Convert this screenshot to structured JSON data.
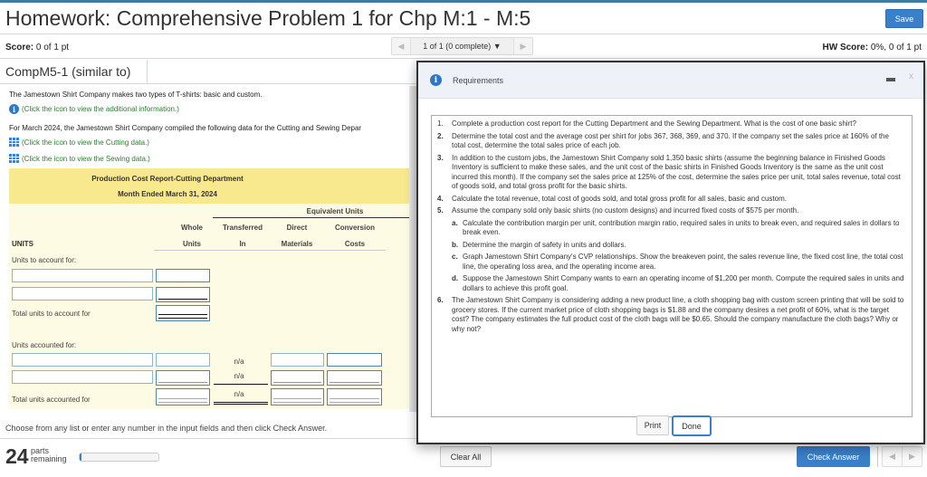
{
  "header": {
    "title": "Homework: Comprehensive Problem 1 for Chp M:1 - M:5",
    "save_label": "Save"
  },
  "scorebar": {
    "score_label": "Score:",
    "score_value": " 0 of 1 pt",
    "pager_prev_icon": "◀",
    "pager_text": "1 of 1 (0 complete) ▼",
    "pager_next_icon": "▶",
    "hw_score_label": "HW Score:",
    "hw_score_value": " 0%, 0 of 1 pt"
  },
  "question": {
    "id": "CompM5-1 (similar to)",
    "intro": "The Jamestown Shirt Company makes two types of T-shirts: basic and custom.",
    "info_link": "(Click the icon to view the additional information.)",
    "data_intro": "For March 2024, the Jamestown Shirt Company compiled the following data for the Cutting and Sewing Depar",
    "cutting_link": "(Click the icon to view the Cutting data.)",
    "sewing_link": "(Click the icon to view the Sewing data.)"
  },
  "report": {
    "title": "Production Cost Report-Cutting Department",
    "subtitle": "Month Ended March 31, 2024",
    "equivalent_units": "Equivalent Units",
    "col_whole_1": "Whole",
    "col_whole_2": "Units",
    "col_trans_1": "Transferred",
    "col_trans_2": "In",
    "col_dm_1": "Direct",
    "col_dm_2": "Materials",
    "col_cc_1": "Conversion",
    "col_cc_2": "Costs",
    "units_label": "UNITS",
    "to_account_for": "Units to account for:",
    "total_to_account_for": "Total units to account for",
    "accounted_for": "Units accounted for:",
    "total_accounted_for": "Total units accounted for",
    "na": "n/a"
  },
  "footer": {
    "instruction": "Choose from any list or enter any number in the input fields and then click Check Answer.",
    "parts_count": "24",
    "parts_label_1": "parts",
    "parts_label_2": "remaining",
    "progress_fraction": 0.02,
    "clear_all": "Clear All",
    "check_answer": "Check Answer",
    "prev_icon": "◀",
    "next_icon": "▶"
  },
  "modal": {
    "title": "Requirements",
    "minimize_icon": "—",
    "close_icon": "x",
    "requirements": [
      {
        "num": "1.",
        "text": "Complete a production cost report for the Cutting Department and the Sewing Department. What is the cost of one basic shirt?"
      },
      {
        "num": "2.",
        "text": "Determine the total cost and the average cost per shirt for jobs 367, 368, 369, and 370. If the company set the sales price at 160% of the total cost, determine the total sales price of each job."
      },
      {
        "num": "3.",
        "text": "In addition to the custom jobs, the Jamestown Shirt Company sold 1,350 basic shirts (assume the beginning balance in Finished Goods Inventory is sufficient to make these sales, and the unit cost of the basic shirts in Finished Goods Inventory is the same as the unit cost incurred this month). If the company set the sales price at 125% of the cost, determine the sales price per unit, total sales revenue, total cost of goods sold, and total gross profit for the basic shirts."
      },
      {
        "num": "4.",
        "text": "Calculate the total revenue, total cost of goods sold, and total gross profit for all sales, basic and custom."
      },
      {
        "num": "5.",
        "text": "Assume the company sold only basic shirts (no custom designs) and incurred fixed costs of $575 per month."
      },
      {
        "num": "6.",
        "text": "The Jamestown Shirt Company is considering adding a new product line, a cloth shopping bag with custom screen printing that will be sold to grocery stores. If the current market price of cloth shopping bags is $1.88 and the company desires a net profit of 60%, what is the target cost? The company estimates the full product cost of the cloth bags will be $0.65. Should the company manufacture the cloth bags? Why or why not?"
      }
    ],
    "sub_requirements": [
      {
        "letter": "a.",
        "text": "Calculate the contribution margin per unit, contribution margin ratio, required sales in units to break even, and required sales in dollars to break even."
      },
      {
        "letter": "b.",
        "text": "Determine the margin of safety in units and dollars."
      },
      {
        "letter": "c.",
        "text": "Graph Jamestown Shirt Company's CVP relationships. Show the breakeven point, the sales revenue line, the fixed cost line, the total cost line, the operating loss area, and the operating income area."
      },
      {
        "letter": "d.",
        "text": "Suppose the Jamestown Shirt Company wants to earn an operating income of $1,200 per month. Compute the required sales in units and dollars to achieve this profit goal."
      }
    ],
    "print_label": "Print",
    "done_label": "Done"
  }
}
